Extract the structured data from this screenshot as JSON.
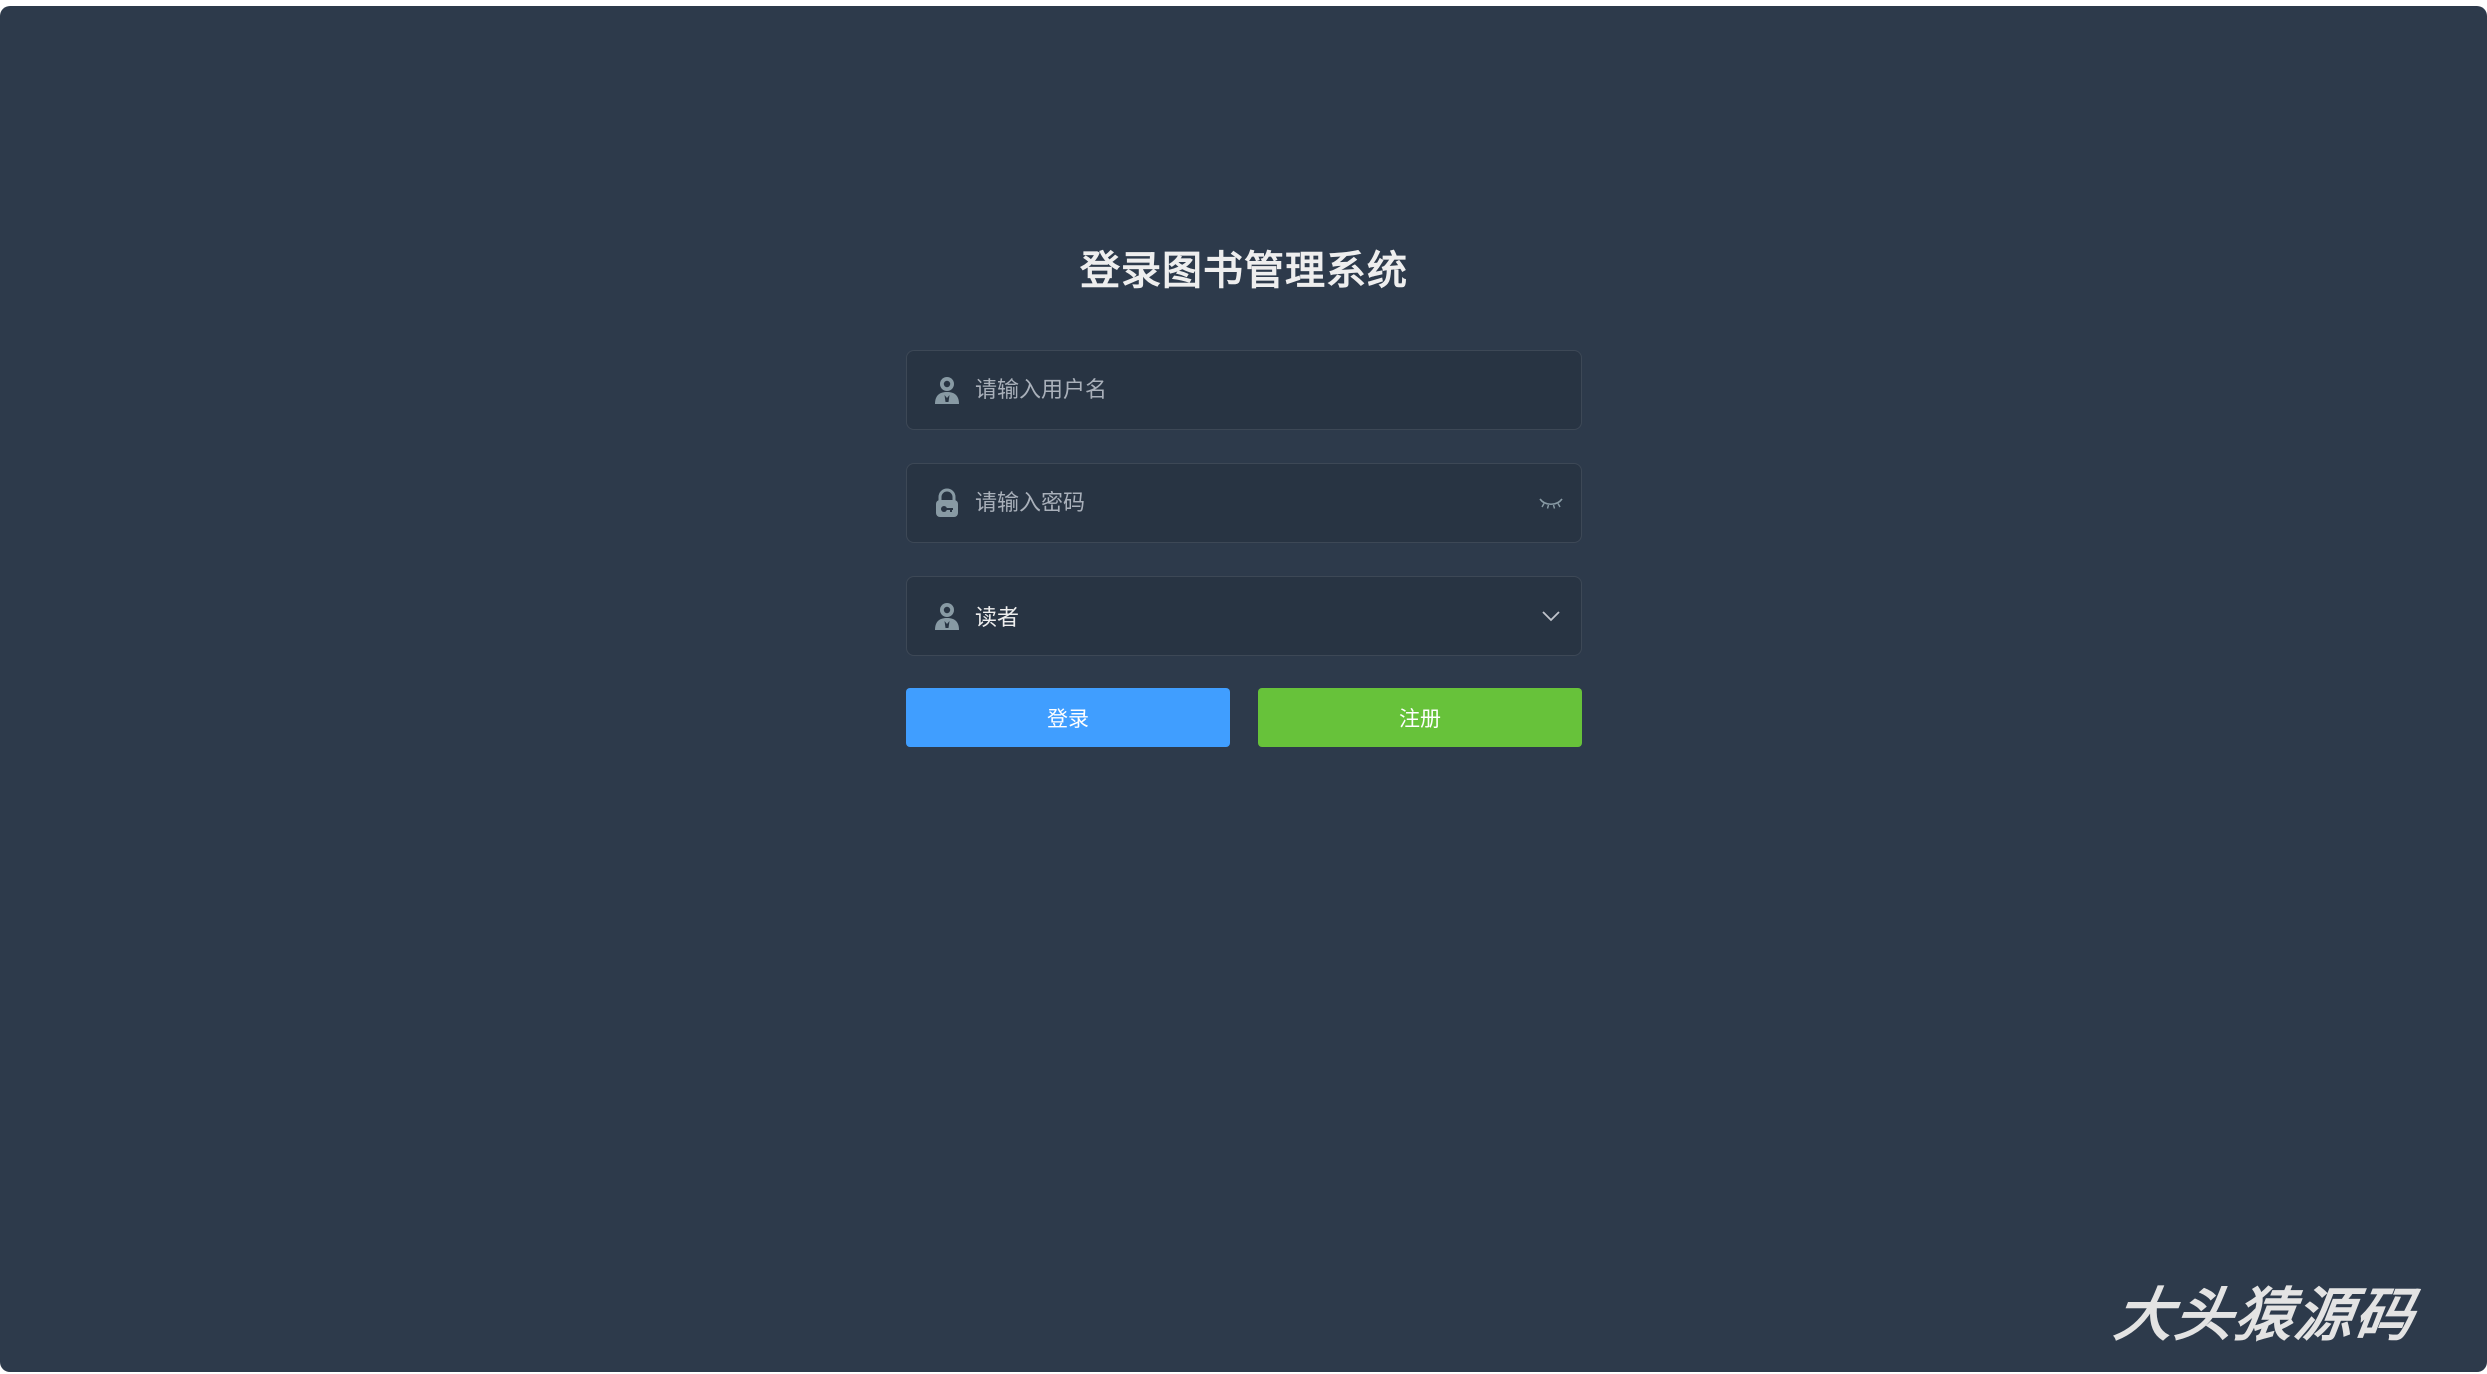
{
  "login": {
    "title": "登录图书管理系统",
    "username": {
      "placeholder": "请输入用户名",
      "value": "",
      "icon": "user-icon"
    },
    "password": {
      "placeholder": "请输入密码",
      "value": "",
      "icon": "lock-icon",
      "toggle_icon": "eye-closed-icon"
    },
    "role": {
      "selected": "读者",
      "icon": "user-icon",
      "dropdown_icon": "chevron-down-icon"
    },
    "buttons": {
      "login_label": "登录",
      "register_label": "注册"
    }
  },
  "watermark": {
    "text": "大头猿源码"
  },
  "colors": {
    "background": "#2d3a4b",
    "field_background": "#283443",
    "login_button": "#409eff",
    "register_button": "#67c23a",
    "title_text": "#eeeeee",
    "placeholder_text": "#a9b0ba",
    "icon": "#889aa4"
  }
}
